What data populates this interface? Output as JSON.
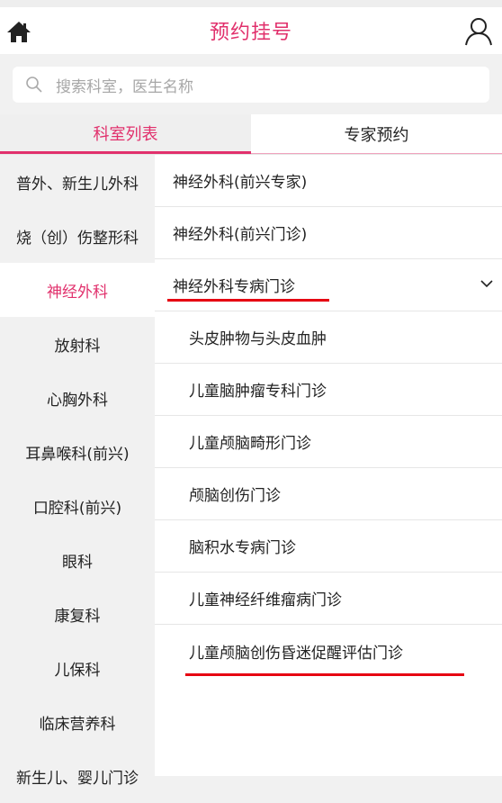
{
  "header": {
    "title": "预约挂号"
  },
  "search": {
    "placeholder": "搜索科室，医生名称"
  },
  "tabs": [
    {
      "label": "科室列表"
    },
    {
      "label": "专家预约"
    }
  ],
  "departments": [
    {
      "label": "普外、新生儿外科"
    },
    {
      "label": "烧（创）伤整形科"
    },
    {
      "label": "神经外科"
    },
    {
      "label": "放射科"
    },
    {
      "label": "心胸外科"
    },
    {
      "label": "耳鼻喉科(前兴)"
    },
    {
      "label": "口腔科(前兴)"
    },
    {
      "label": "眼科"
    },
    {
      "label": "康复科"
    },
    {
      "label": "儿保科"
    },
    {
      "label": "临床营养科"
    },
    {
      "label": "新生儿、婴儿门诊"
    }
  ],
  "clinics": [
    {
      "label": "神经外科(前兴专家)"
    },
    {
      "label": "神经外科(前兴门诊)"
    },
    {
      "label": "神经外科专病门诊"
    }
  ],
  "subclinics": [
    {
      "label": "头皮肿物与头皮血肿"
    },
    {
      "label": "儿童脑肿瘤专科门诊"
    },
    {
      "label": "儿童颅脑畸形门诊"
    },
    {
      "label": "颅脑创伤门诊"
    },
    {
      "label": "脑积水专病门诊"
    },
    {
      "label": "儿童神经纤维瘤病门诊"
    },
    {
      "label": "儿童颅脑创伤昏迷促醒评估门诊"
    }
  ],
  "colors": {
    "accent": "#e1306c",
    "annotation": "#e60012"
  }
}
